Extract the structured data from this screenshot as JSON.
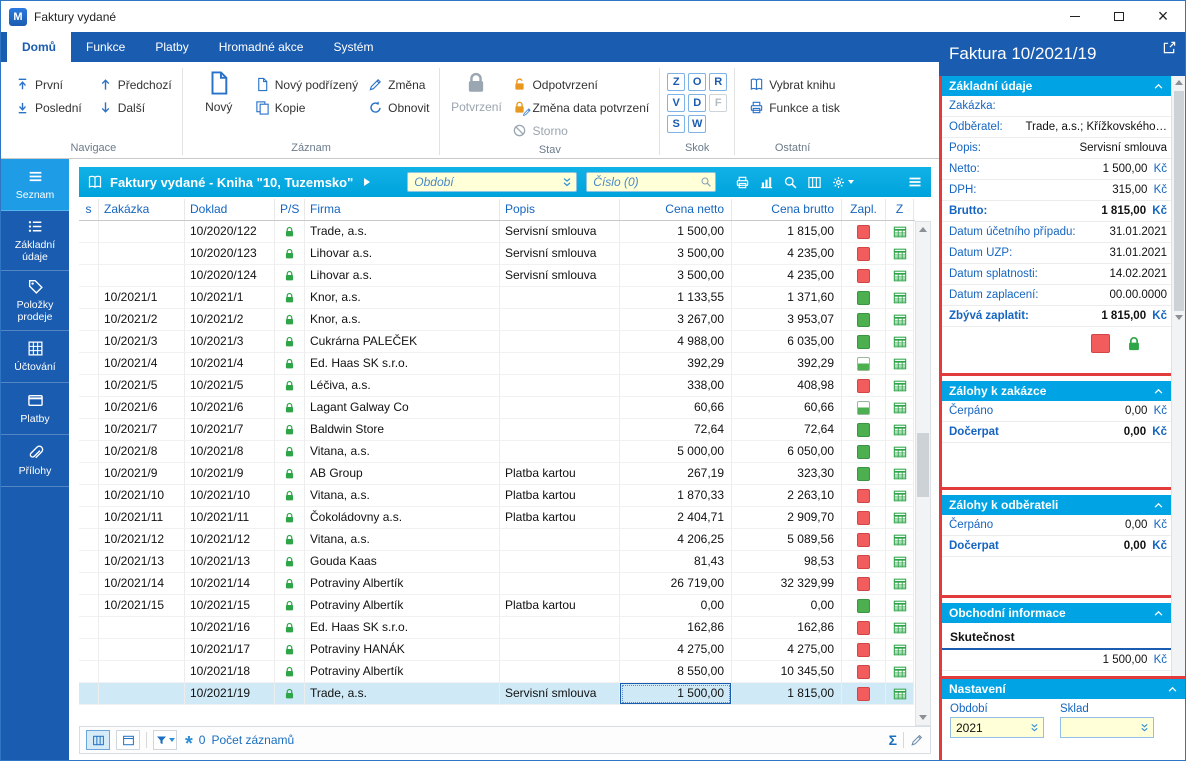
{
  "window": {
    "title": "Faktury vydané"
  },
  "tabs": [
    {
      "label": "Domů",
      "active": true
    },
    {
      "label": "Funkce",
      "active": false
    },
    {
      "label": "Platby",
      "active": false
    },
    {
      "label": "Hromadné akce",
      "active": false
    },
    {
      "label": "Systém",
      "active": false
    }
  ],
  "ribbon": {
    "groups": {
      "navigace": "Navigace",
      "zaznam": "Záznam",
      "stav": "Stav",
      "skok": "Skok",
      "ostatni": "Ostatní"
    },
    "first": "První",
    "last": "Poslední",
    "prev": "Předchozí",
    "next": "Další",
    "new": "Nový",
    "new_child": "Nový podřízený",
    "copy": "Kopie",
    "change": "Změna",
    "refresh": "Obnovit",
    "confirm": "Potvrzení",
    "unconfirm": "Odpotvrzení",
    "confirm_date": "Změna data potvrzení",
    "storno": "Storno",
    "jump_letters": [
      {
        "ch": "Z",
        "disabled": false
      },
      {
        "ch": "O",
        "disabled": false
      },
      {
        "ch": "R",
        "disabled": false
      },
      {
        "ch": "V",
        "disabled": false
      },
      {
        "ch": "D",
        "disabled": false
      },
      {
        "ch": "F",
        "disabled": true
      },
      {
        "ch": "S",
        "disabled": false
      },
      {
        "ch": "W",
        "disabled": false
      }
    ],
    "select_book": "Vybrat knihu",
    "functions_print": "Funkce a tisk"
  },
  "sidebar": [
    {
      "label": "Seznam",
      "icon": "menu-icon",
      "active": true
    },
    {
      "label": "Základní údaje",
      "icon": "form-icon",
      "active": false
    },
    {
      "label": "Položky prodeje",
      "icon": "items-icon",
      "active": false
    },
    {
      "label": "Účtování",
      "icon": "accounting-icon",
      "active": false
    },
    {
      "label": "Platby",
      "icon": "payments-icon",
      "active": false
    },
    {
      "label": "Přílohy",
      "icon": "attachments-icon",
      "active": false
    }
  ],
  "browse": {
    "title": "Faktury vydané - Kniha \"10, Tuzemsko\"",
    "period_filter": {
      "placeholder": "Období",
      "value": ""
    },
    "number_filter": {
      "placeholder": "Číslo (0)",
      "value": ""
    },
    "columns": [
      "s",
      "Zakázka",
      "Doklad",
      "P/S",
      "Firma",
      "Popis",
      "Cena netto",
      "Cena brutto",
      "Zapl.",
      "Z"
    ],
    "rows": [
      {
        "zakazka": "",
        "doklad": "10/2020/122",
        "locked": true,
        "firma": "Trade, a.s.",
        "popis": "Servisní smlouva",
        "netto": "1 500,00",
        "brutto": "1 815,00",
        "paid": "unpaid",
        "selected": false
      },
      {
        "zakazka": "",
        "doklad": "10/2020/123",
        "locked": true,
        "firma": "Lihovar a.s.",
        "popis": "Servisní smlouva",
        "netto": "3 500,00",
        "brutto": "4 235,00",
        "paid": "unpaid",
        "selected": false
      },
      {
        "zakazka": "",
        "doklad": "10/2020/124",
        "locked": true,
        "firma": "Lihovar a.s.",
        "popis": "Servisní smlouva",
        "netto": "3 500,00",
        "brutto": "4 235,00",
        "paid": "unpaid",
        "selected": false
      },
      {
        "zakazka": "10/2021/1",
        "doklad": "10/2021/1",
        "locked": true,
        "firma": "Knor, a.s.",
        "popis": "",
        "netto": "1 133,55",
        "brutto": "1 371,60",
        "paid": "paid",
        "selected": false
      },
      {
        "zakazka": "10/2021/2",
        "doklad": "10/2021/2",
        "locked": true,
        "firma": "Knor, a.s.",
        "popis": "",
        "netto": "3 267,00",
        "brutto": "3 953,07",
        "paid": "paid",
        "selected": false
      },
      {
        "zakazka": "10/2021/3",
        "doklad": "10/2021/3",
        "locked": true,
        "firma": "Cukrárna PALEČEK",
        "popis": "",
        "netto": "4 988,00",
        "brutto": "6 035,00",
        "paid": "paid",
        "selected": false
      },
      {
        "zakazka": "10/2021/4",
        "doklad": "10/2021/4",
        "locked": true,
        "firma": "Ed. Haas SK s.r.o.",
        "popis": "",
        "netto": "392,29",
        "brutto": "392,29",
        "paid": "partial",
        "selected": false
      },
      {
        "zakazka": "10/2021/5",
        "doklad": "10/2021/5",
        "locked": true,
        "firma": "Léčiva, a.s.",
        "popis": "",
        "netto": "338,00",
        "brutto": "408,98",
        "paid": "unpaid",
        "selected": false
      },
      {
        "zakazka": "10/2021/6",
        "doklad": "10/2021/6",
        "locked": true,
        "firma": "Lagant Galway Co",
        "popis": "",
        "netto": "60,66",
        "brutto": "60,66",
        "paid": "partial",
        "selected": false
      },
      {
        "zakazka": "10/2021/7",
        "doklad": "10/2021/7",
        "locked": true,
        "firma": "Baldwin Store",
        "popis": "",
        "netto": "72,64",
        "brutto": "72,64",
        "paid": "paid",
        "selected": false
      },
      {
        "zakazka": "10/2021/8",
        "doklad": "10/2021/8",
        "locked": true,
        "firma": "Vitana, a.s.",
        "popis": "",
        "netto": "5 000,00",
        "brutto": "6 050,00",
        "paid": "paid",
        "selected": false
      },
      {
        "zakazka": "10/2021/9",
        "doklad": "10/2021/9",
        "locked": true,
        "firma": "AB Group",
        "popis": "Platba kartou",
        "netto": "267,19",
        "brutto": "323,30",
        "paid": "paid",
        "selected": false
      },
      {
        "zakazka": "10/2021/10",
        "doklad": "10/2021/10",
        "locked": true,
        "firma": "Vitana, a.s.",
        "popis": "Platba kartou",
        "netto": "1 870,33",
        "brutto": "2 263,10",
        "paid": "unpaid",
        "selected": false
      },
      {
        "zakazka": "10/2021/11",
        "doklad": "10/2021/11",
        "locked": true,
        "firma": "Čokoládovny a.s.",
        "popis": "Platba kartou",
        "netto": "2 404,71",
        "brutto": "2 909,70",
        "paid": "unpaid",
        "selected": false
      },
      {
        "zakazka": "10/2021/12",
        "doklad": "10/2021/12",
        "locked": true,
        "firma": "Vitana, a.s.",
        "popis": "",
        "netto": "4 206,25",
        "brutto": "5 089,56",
        "paid": "unpaid",
        "selected": false
      },
      {
        "zakazka": "10/2021/13",
        "doklad": "10/2021/13",
        "locked": true,
        "firma": "Gouda Kaas",
        "popis": "",
        "netto": "81,43",
        "brutto": "98,53",
        "paid": "unpaid",
        "selected": false
      },
      {
        "zakazka": "10/2021/14",
        "doklad": "10/2021/14",
        "locked": true,
        "firma": "Potraviny Albertík",
        "popis": "",
        "netto": "26 719,00",
        "brutto": "32 329,99",
        "paid": "unpaid",
        "selected": false
      },
      {
        "zakazka": "10/2021/15",
        "doklad": "10/2021/15",
        "locked": true,
        "firma": "Potraviny Albertík",
        "popis": "Platba kartou",
        "netto": "0,00",
        "brutto": "0,00",
        "paid": "paid",
        "selected": false
      },
      {
        "zakazka": "",
        "doklad": "10/2021/16",
        "locked": true,
        "firma": "Ed. Haas SK s.r.o.",
        "popis": "",
        "netto": "162,86",
        "brutto": "162,86",
        "paid": "unpaid",
        "selected": false
      },
      {
        "zakazka": "",
        "doklad": "10/2021/17",
        "locked": true,
        "firma": "Potraviny HANÁK",
        "popis": "",
        "netto": "4 275,00",
        "brutto": "4 275,00",
        "paid": "unpaid",
        "selected": false
      },
      {
        "zakazka": "",
        "doklad": "10/2021/18",
        "locked": true,
        "firma": "Potraviny Albertík",
        "popis": "",
        "netto": "8 550,00",
        "brutto": "10 345,50",
        "paid": "unpaid",
        "selected": false
      },
      {
        "zakazka": "",
        "doklad": "10/2021/19",
        "locked": true,
        "firma": "Trade, a.s.",
        "popis": "Servisní smlouva",
        "netto": "1 500,00",
        "brutto": "1 815,00",
        "paid": "unpaid",
        "selected": true
      }
    ]
  },
  "statusbar": {
    "filter_count": "0",
    "count_label": "Počet záznamů"
  },
  "detail": {
    "title": "Faktura 10/2021/19",
    "sections": [
      {
        "title": "Základní údaje",
        "fields": [
          {
            "label": "Zakázka:",
            "value": "",
            "unit": "",
            "bold": false
          },
          {
            "label": "Odběratel:",
            "value": "Trade, a.s.; Křížkovského…",
            "unit": "",
            "bold": false
          },
          {
            "label": "Popis:",
            "value": "Servisní smlouva",
            "unit": "",
            "bold": false
          },
          {
            "label": "Netto:",
            "value": "1 500,00",
            "unit": "Kč",
            "bold": false
          },
          {
            "label": "DPH:",
            "value": "315,00",
            "unit": "Kč",
            "bold": false
          },
          {
            "label": "Brutto:",
            "value": "1 815,00",
            "unit": "Kč",
            "bold": true
          },
          {
            "label": "Datum účetního případu:",
            "value": "31.01.2021",
            "unit": "",
            "bold": false
          },
          {
            "label": "Datum UZP:",
            "value": "31.01.2021",
            "unit": "",
            "bold": false
          },
          {
            "label": "Datum splatnosti:",
            "value": "14.02.2021",
            "unit": "",
            "bold": false
          },
          {
            "label": "Datum zaplacení:",
            "value": "00.00.0000",
            "unit": "",
            "bold": false
          },
          {
            "label": "Zbývá zaplatit:",
            "value": "1 815,00",
            "unit": "Kč",
            "bold": true
          }
        ],
        "status_icons": true
      },
      {
        "title": "Zálohy k zakázce",
        "fields": [
          {
            "label": "Čerpáno",
            "value": "0,00",
            "unit": "Kč",
            "bold": false
          },
          {
            "label": "Dočerpat",
            "value": "0,00",
            "unit": "Kč",
            "bold": true
          }
        ]
      },
      {
        "title": "Zálohy k odběrateli",
        "fields": [
          {
            "label": "Čerpáno",
            "value": "0,00",
            "unit": "Kč",
            "bold": false
          },
          {
            "label": "Dočerpat",
            "value": "0,00",
            "unit": "Kč",
            "bold": true
          }
        ]
      },
      {
        "title": "Obchodní informace",
        "subtitle": "Skutečnost",
        "fields": [
          {
            "label": "",
            "value": "1 500,00",
            "unit": "Kč",
            "bold": false
          }
        ]
      }
    ],
    "settings": {
      "title": "Nastavení",
      "period_label": "Období",
      "period_value": "2021",
      "warehouse_label": "Sklad",
      "warehouse_value": ""
    }
  }
}
